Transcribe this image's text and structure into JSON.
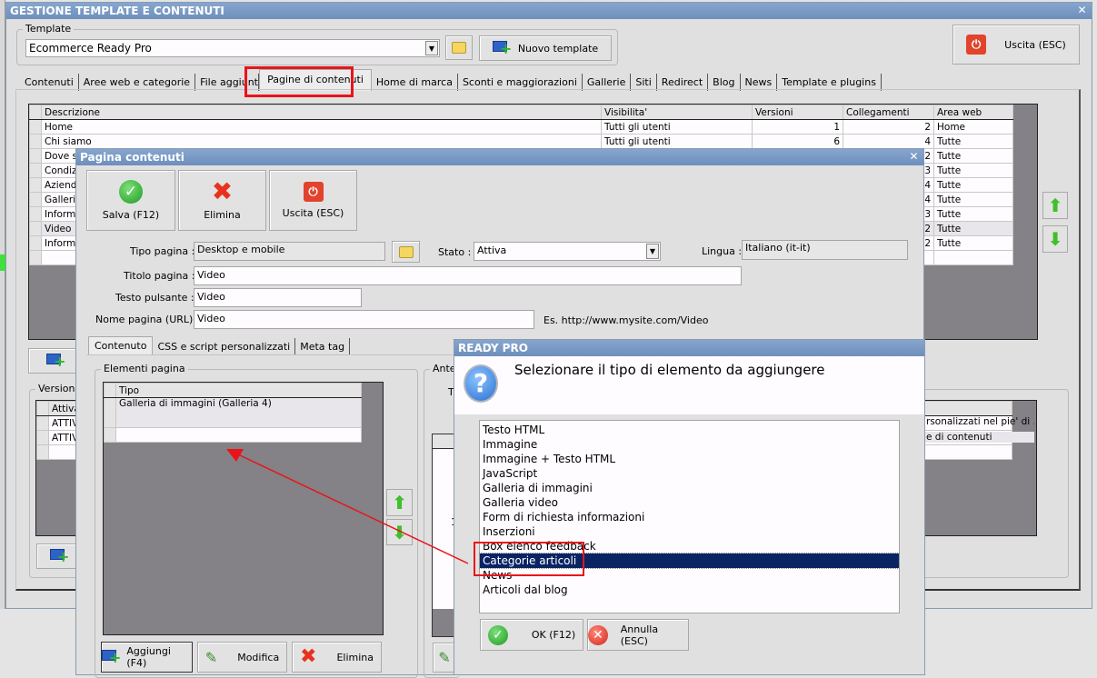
{
  "main_window": {
    "title": "GESTIONE TEMPLATE E CONTENUTI",
    "close_icon": "close-icon",
    "template_group": "Template",
    "template_value": "Ecommerce Ready Pro",
    "new_template": "Nuovo template",
    "exit": "Uscita (ESC)",
    "tabs": [
      "Contenuti",
      "Aree web e categorie",
      "File aggiuntivi",
      "Pagine di contenuti",
      "Home di marca",
      "Sconti e maggiorazioni",
      "Gallerie",
      "Siti",
      "Redirect",
      "Blog",
      "News",
      "Template e plugins"
    ],
    "active_tab": "Pagine di contenuti",
    "grid": {
      "columns": [
        "Descrizione",
        "Visibilita'",
        "Versioni",
        "Collegamenti",
        "Area web"
      ],
      "rows": [
        [
          "Home",
          "Tutti gli utenti",
          "1",
          "2",
          "Home"
        ],
        [
          "Chi siamo",
          "Tutti gli utenti",
          "6",
          "4",
          "Tutte"
        ],
        [
          "Dove si",
          "",
          "",
          "2",
          "Tutte"
        ],
        [
          "Condizi",
          "",
          "",
          "3",
          "Tutte"
        ],
        [
          "Azienda",
          "",
          "",
          "4",
          "Tutte"
        ],
        [
          "Galleria",
          "",
          "",
          "4",
          "Tutte"
        ],
        [
          "Informa",
          "",
          "",
          "3",
          "Tutte"
        ],
        [
          "Video",
          "",
          "",
          "2",
          "Tutte"
        ],
        [
          "Informa",
          "",
          "",
          "2",
          "Tutte"
        ]
      ]
    },
    "versions_group": "Versioni p",
    "versions_header": "Attiva",
    "versions_rows": [
      "ATTIV",
      "ATTIV"
    ],
    "right_fragment": [
      "rsonalizzati nel pie' di ...",
      "e di contenuti"
    ]
  },
  "page_dialog": {
    "title": "Pagina contenuti",
    "buttons": {
      "save": "Salva (F12)",
      "delete": "Elimina",
      "exit": "Uscita (ESC)"
    },
    "fields": {
      "tipo_label": "Tipo pagina :",
      "tipo_value": "Desktop e mobile",
      "stato_label": "Stato :",
      "stato_value": "Attiva",
      "lingua_label": "Lingua :",
      "lingua_value": "Italiano (it-it)",
      "titolo_label": "Titolo pagina :",
      "titolo_value": "Video",
      "testo_label": "Testo pulsante :",
      "testo_value": "Video",
      "nome_label": "Nome pagina (URL) :",
      "nome_value": "Video",
      "url_example": "Es. http://www.mysite.com/Video"
    },
    "tabs": [
      "Contenuto",
      "CSS e script personalizzati",
      "Meta tag"
    ],
    "elements_group": "Elementi pagina",
    "elements_header": "Tipo",
    "elements_rows": [
      "Galleria di immagini (Galleria 4)"
    ],
    "preview_group": "Antep",
    "preview_letter": "T",
    "preview_num": "1",
    "bottom_buttons": {
      "add": "Aggiungi (F4)",
      "edit": "Modifica",
      "delete": "Elimina"
    }
  },
  "ready_dialog": {
    "title": "READY PRO",
    "question": "Selezionare il tipo di elemento da aggiungere",
    "items": [
      "Testo HTML",
      "Immagine",
      "Immagine + Testo HTML",
      "JavaScript",
      "Galleria di immagini",
      "Galleria video",
      "Form di richiesta informazioni",
      "Inserzioni",
      "Box elenco feedback",
      "Categorie articoli",
      "News",
      "Articoli dal blog"
    ],
    "selected": "Categorie articoli",
    "ok": "OK (F12)",
    "cancel": "Annulla (ESC)"
  },
  "colors": {
    "title_bar": "#6e8fbb",
    "selection": "#0a2463",
    "annotation": "#e8141a"
  }
}
